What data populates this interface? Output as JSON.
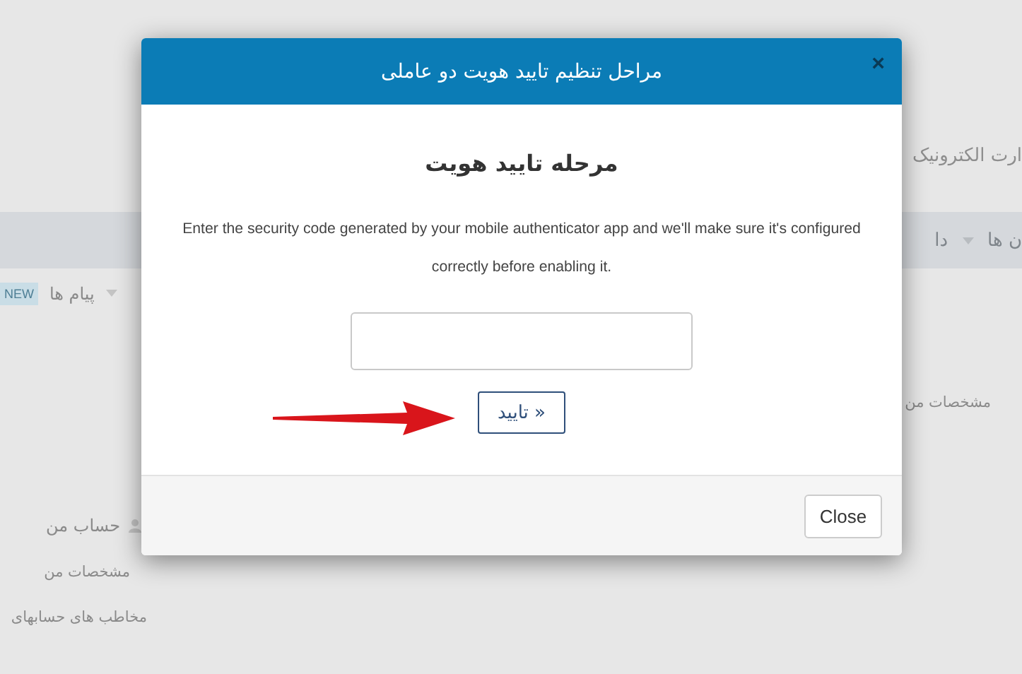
{
  "page": {
    "site_title": "ارت الکترونیک",
    "nav_items": [
      "ن ها",
      "دا"
    ],
    "subnav": {
      "messages": "پیام ها",
      "badge": "NEW"
    },
    "profile_label": "مشخصات من",
    "sidebar": {
      "heading": "حساب من",
      "items": [
        "مشخصات من",
        "مخاطب های حسابهای"
      ]
    }
  },
  "modal": {
    "title": "مراحل تنظیم تایید هویت دو عاملی",
    "close_glyph": "×",
    "heading": "مرحله تایید هویت",
    "instructions": "Enter the security code generated by your mobile authenticator app and we'll make sure it's configured correctly before enabling it.",
    "submit": "« تایید",
    "footer_button": "Close"
  }
}
